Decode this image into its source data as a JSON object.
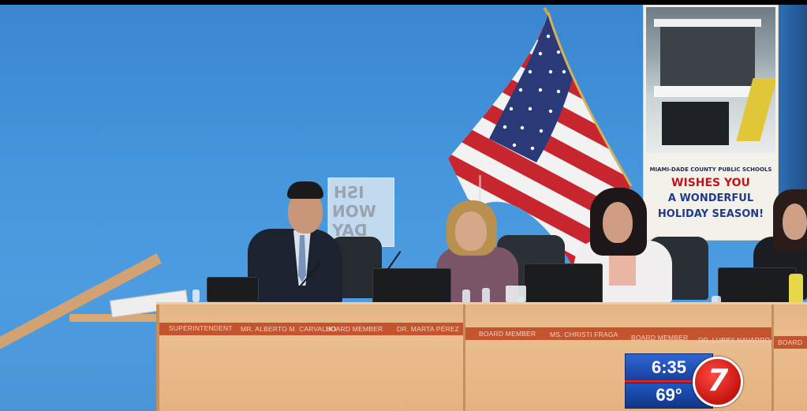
{
  "banner": {
    "org": "MIAMI-DADE COUNTY PUBLIC SCHOOLS",
    "line1": "WISHES YOU",
    "line2": "A WONDERFUL",
    "line3": "HOLIDAY SEASON!"
  },
  "reversed_sign": {
    "line1": "ISH",
    "line2": "WON",
    "line3": "DAY"
  },
  "placards": [
    {
      "title": "SUPERINTENDENT",
      "name": "MR. ALBERTO M. CARVALHO"
    },
    {
      "title": "BOARD MEMBER",
      "name": "DR. MARTA PÉREZ"
    },
    {
      "title": "BOARD MEMBER",
      "name": "MS. CHRISTI FRAGA"
    },
    {
      "title": "BOARD MEMBER",
      "name": "DR. LUBBY NAVARRO"
    },
    {
      "title": "BOARD",
      "name": ""
    }
  ],
  "bug": {
    "time": "6:35",
    "temp": "69°",
    "channel": "7"
  },
  "colors": {
    "wall": "#3f8fd6",
    "desk": "#e7b98a",
    "placard_strip": "#c3542d",
    "bug_blue": "#1e4fb8",
    "bug_red": "#d8231f"
  }
}
